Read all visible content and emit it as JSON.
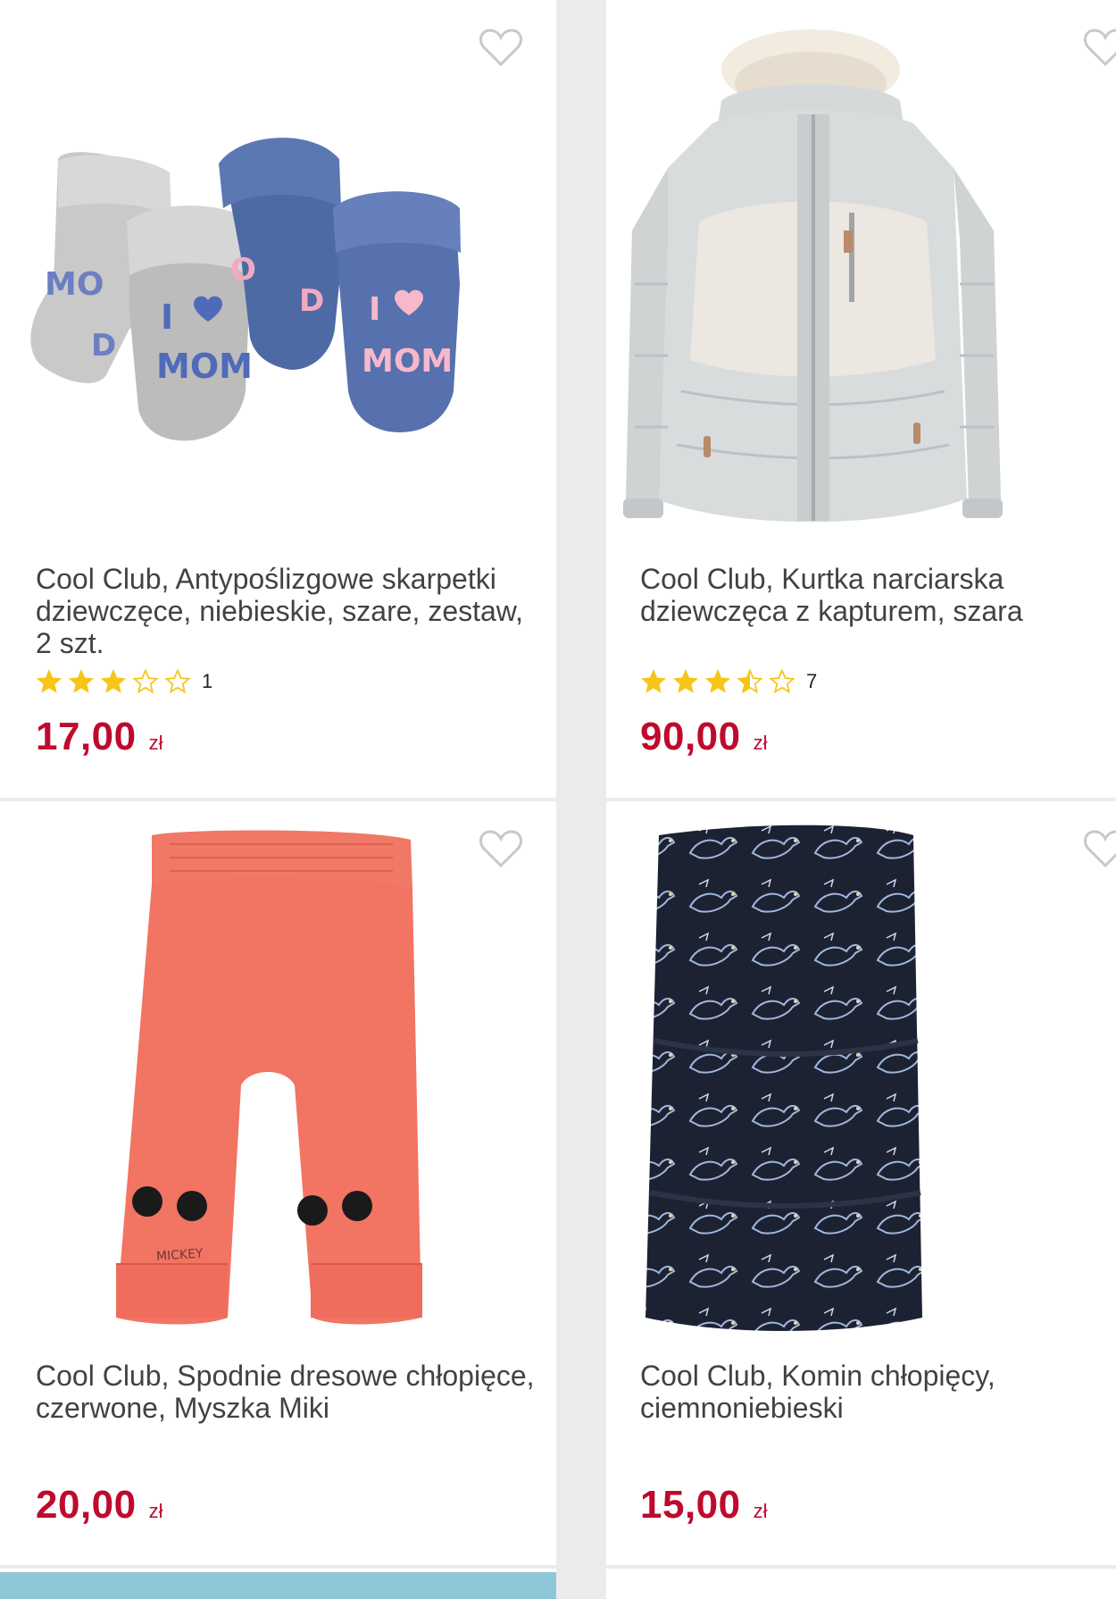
{
  "products": [
    {
      "title": "Cool Club, Antypoślizgowe skarpetki dziewczęce, niebieskie, szare, zestaw, 2 szt.",
      "image_desc": "socks-set-icon",
      "rating": 3,
      "rating_count": "1",
      "price": "17,00",
      "currency": "zł"
    },
    {
      "title": "Cool Club, Kurtka narciarska dziewczęca z kapturem, szara",
      "image_desc": "ski-jacket-icon",
      "rating": 3.5,
      "rating_count": "7",
      "price": "90,00",
      "currency": "zł"
    },
    {
      "title": "Cool Club, Spodnie dresowe chłopięce, czerwone, Myszka Miki",
      "image_desc": "sweatpants-icon",
      "price": "20,00",
      "currency": "zł"
    },
    {
      "title": "Cool Club, Komin chłopięcy, ciemnoniebieski",
      "image_desc": "neck-warmer-icon",
      "price": "15,00",
      "currency": "zł"
    }
  ],
  "colors": {
    "price": "#be0a2d",
    "star": "#f5c518",
    "title": "#424242",
    "background": "#ebebeb",
    "card": "#ffffff"
  }
}
